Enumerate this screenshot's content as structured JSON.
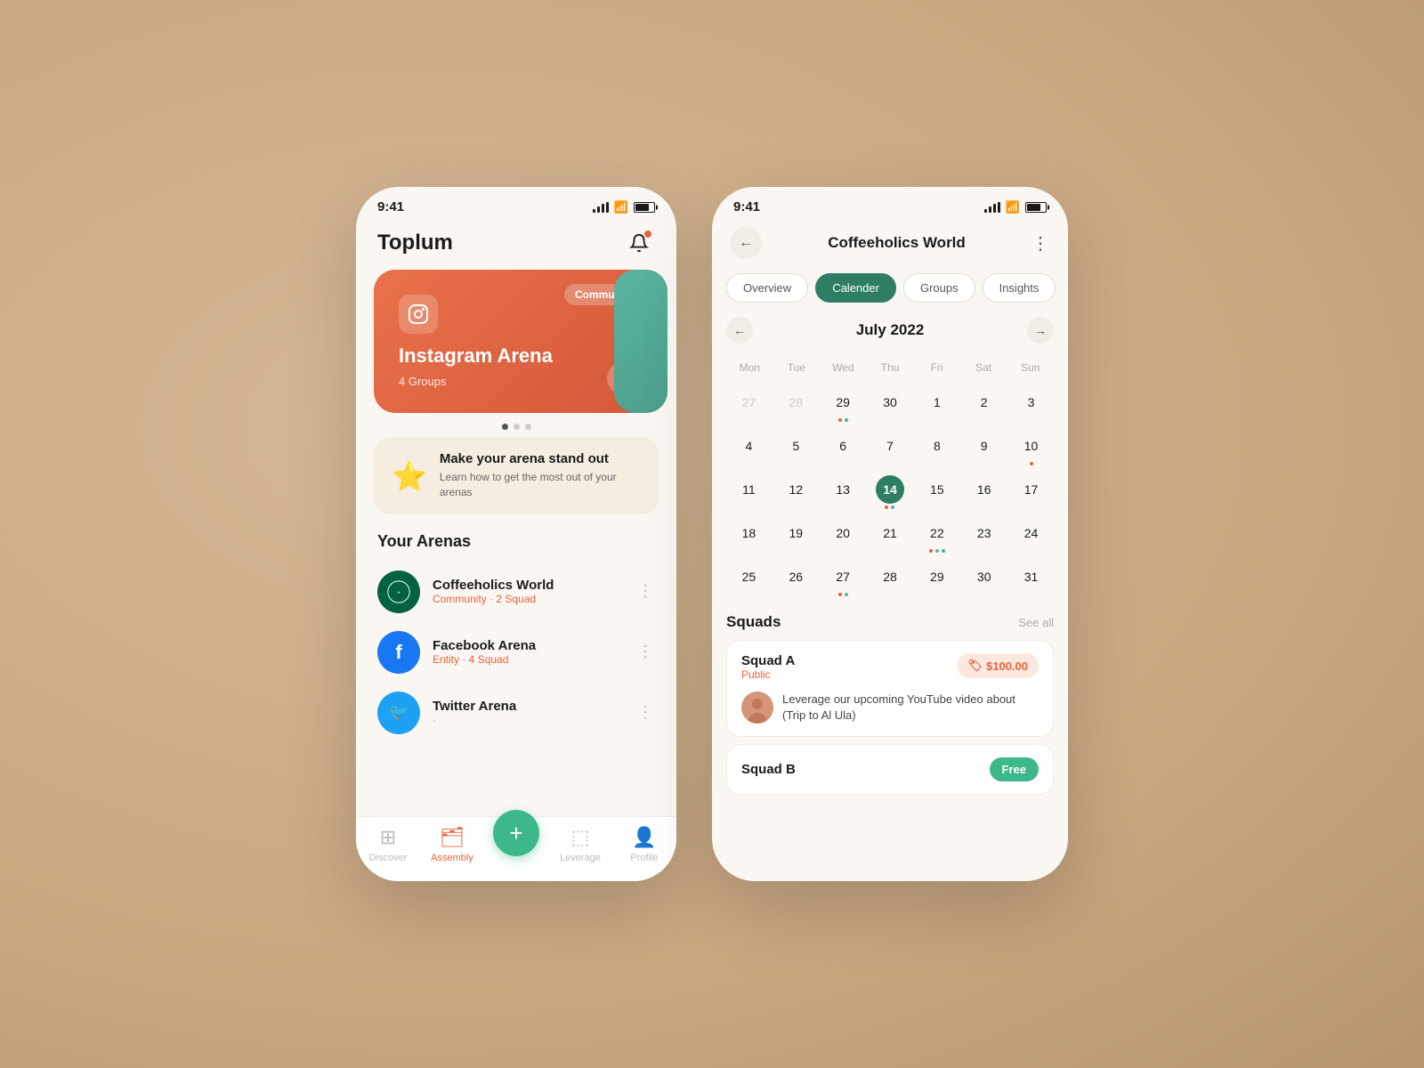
{
  "left_phone": {
    "status": {
      "time": "9:41"
    },
    "header": {
      "title": "Toplum"
    },
    "arena_card": {
      "badge": "Community",
      "title": "Instagram Arena",
      "groups": "4 Groups",
      "arrow": "→"
    },
    "dots": [
      "active",
      "inactive",
      "inactive"
    ],
    "promo": {
      "title": "Make your arena stand out",
      "subtitle": "Learn how to get the most out of your arenas"
    },
    "arenas_title": "Your Arenas",
    "arenas": [
      {
        "name": "Coffeeholics World",
        "type": "Community",
        "squads": "2 Squad",
        "logo_type": "starbucks"
      },
      {
        "name": "Facebook Arena",
        "type": "Entity",
        "squads": "4 Squad",
        "logo_type": "facebook"
      },
      {
        "name": "Twitter Arena",
        "type": "",
        "squads": "",
        "logo_type": "twitter"
      }
    ],
    "bottom_nav": [
      {
        "label": "Discover",
        "icon": "⊞",
        "active": false
      },
      {
        "label": "Assembly",
        "icon": "🗂",
        "active": true
      },
      {
        "label": "plus",
        "icon": "+",
        "active": false
      },
      {
        "label": "Leverage",
        "icon": "⬚",
        "active": false
      },
      {
        "label": "Profile",
        "icon": "👤",
        "active": false
      }
    ]
  },
  "right_phone": {
    "status": {
      "time": "9:41"
    },
    "header": {
      "back": "←",
      "title": "Coffeeholics World",
      "more": "⋮"
    },
    "tabs": [
      {
        "label": "Overview",
        "active": false
      },
      {
        "label": "Calender",
        "active": true
      },
      {
        "label": "Groups",
        "active": false
      },
      {
        "label": "Insights",
        "active": false
      }
    ],
    "calendar": {
      "prev": "←",
      "next": "→",
      "month": "July 2022",
      "day_names": [
        "Mon",
        "Tue",
        "Wed",
        "Thu",
        "Fri",
        "Sat",
        "Sun"
      ],
      "weeks": [
        [
          {
            "num": "27",
            "other": true,
            "today": false,
            "dots": []
          },
          {
            "num": "28",
            "other": true,
            "today": false,
            "dots": []
          },
          {
            "num": "29",
            "other": false,
            "today": false,
            "dots": [
              "orange",
              "green"
            ]
          },
          {
            "num": "30",
            "other": false,
            "today": false,
            "dots": []
          },
          {
            "num": "1",
            "other": false,
            "today": false,
            "dots": []
          },
          {
            "num": "2",
            "other": false,
            "today": false,
            "dots": []
          },
          {
            "num": "3",
            "other": false,
            "today": false,
            "dots": []
          }
        ],
        [
          {
            "num": "4",
            "other": false,
            "today": false,
            "dots": []
          },
          {
            "num": "5",
            "other": false,
            "today": false,
            "dots": []
          },
          {
            "num": "6",
            "other": false,
            "today": false,
            "dots": []
          },
          {
            "num": "7",
            "other": false,
            "today": false,
            "dots": []
          },
          {
            "num": "8",
            "other": false,
            "today": false,
            "dots": []
          },
          {
            "num": "9",
            "other": false,
            "today": false,
            "dots": []
          },
          {
            "num": "10",
            "other": false,
            "today": false,
            "dots": [
              "orange"
            ]
          }
        ],
        [
          {
            "num": "11",
            "other": false,
            "today": false,
            "dots": []
          },
          {
            "num": "12",
            "other": false,
            "today": false,
            "dots": []
          },
          {
            "num": "13",
            "other": false,
            "today": false,
            "dots": []
          },
          {
            "num": "14",
            "other": false,
            "today": true,
            "dots": [
              "orange",
              "teal"
            ]
          },
          {
            "num": "15",
            "other": false,
            "today": false,
            "dots": []
          },
          {
            "num": "16",
            "other": false,
            "today": false,
            "dots": []
          },
          {
            "num": "17",
            "other": false,
            "today": false,
            "dots": []
          }
        ],
        [
          {
            "num": "18",
            "other": false,
            "today": false,
            "dots": []
          },
          {
            "num": "19",
            "other": false,
            "today": false,
            "dots": []
          },
          {
            "num": "20",
            "other": false,
            "today": false,
            "dots": []
          },
          {
            "num": "21",
            "other": false,
            "today": false,
            "dots": []
          },
          {
            "num": "22",
            "other": false,
            "today": false,
            "dots": [
              "orange",
              "teal",
              "green"
            ]
          },
          {
            "num": "23",
            "other": false,
            "today": false,
            "dots": []
          },
          {
            "num": "24",
            "other": false,
            "today": false,
            "dots": []
          }
        ],
        [
          {
            "num": "25",
            "other": false,
            "today": false,
            "dots": []
          },
          {
            "num": "26",
            "other": false,
            "today": false,
            "dots": []
          },
          {
            "num": "27",
            "other": false,
            "today": false,
            "dots": [
              "orange",
              "teal"
            ]
          },
          {
            "num": "28",
            "other": false,
            "today": false,
            "dots": []
          },
          {
            "num": "29",
            "other": false,
            "today": false,
            "dots": []
          },
          {
            "num": "30",
            "other": false,
            "today": false,
            "dots": []
          },
          {
            "num": "31",
            "other": false,
            "today": false,
            "dots": []
          }
        ]
      ]
    },
    "squads_title": "Squads",
    "see_all": "See all",
    "squad_a": {
      "name": "Squad A",
      "type": "Public",
      "price": "$100.00",
      "post_text": "Leverage our upcoming YouTube video about (Trip to Al Ula)"
    },
    "squad_b": {
      "name": "Squad B",
      "type": ""
    }
  }
}
